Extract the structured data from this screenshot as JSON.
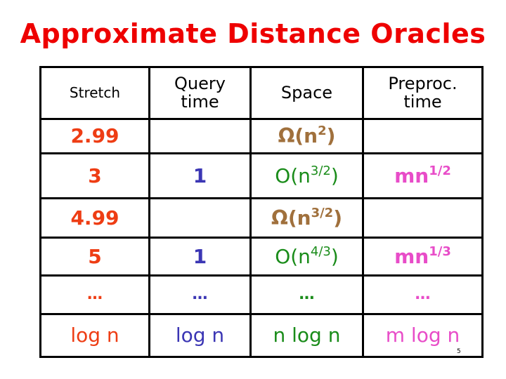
{
  "title": "Approximate Distance Oracles",
  "colors": {
    "title": "#ee0000",
    "stretch": "#ee3d14",
    "query_time": "#3b36b4",
    "space_upper": "#1a8c1a",
    "space_lower": "#a0703c",
    "preproc_time": "#e84cc8"
  },
  "table": {
    "headers": [
      "Stretch",
      "Query time",
      "Space",
      "Preproc. time"
    ],
    "header_lines": {
      "query": [
        "Query",
        "time"
      ],
      "preproc": [
        "Preproc.",
        "time"
      ]
    },
    "rows": [
      {
        "stretch": "2.99",
        "query": "",
        "space_base": "Ω(n",
        "space_exp": "2",
        "space_close": ")",
        "space_kind": "lower",
        "preproc_base": "",
        "preproc_exp": ""
      },
      {
        "stretch": "3",
        "query": "1",
        "space_base": "O(n",
        "space_exp": "3/2",
        "space_close": ")",
        "space_kind": "upper",
        "preproc_base": "mn",
        "preproc_exp": "1/2"
      },
      {
        "stretch": "4.99",
        "query": "",
        "space_base": "Ω(n",
        "space_exp": "3/2",
        "space_close": ")",
        "space_kind": "lower",
        "preproc_base": "",
        "preproc_exp": ""
      },
      {
        "stretch": "5",
        "query": "1",
        "space_base": "O(n",
        "space_exp": "4/3",
        "space_close": ")",
        "space_kind": "upper",
        "preproc_base": "mn",
        "preproc_exp": "1/3"
      },
      {
        "stretch": "…",
        "query": "…",
        "space_base": "…",
        "space_exp": "",
        "space_close": "",
        "space_kind": "upper",
        "preproc_base": "…",
        "preproc_exp": ""
      },
      {
        "stretch": "log n",
        "query": "log n",
        "space_base": "n log n",
        "space_exp": "",
        "space_close": "",
        "space_kind": "upper",
        "preproc_base": "m log n",
        "preproc_exp": ""
      }
    ]
  },
  "page_number": "5"
}
